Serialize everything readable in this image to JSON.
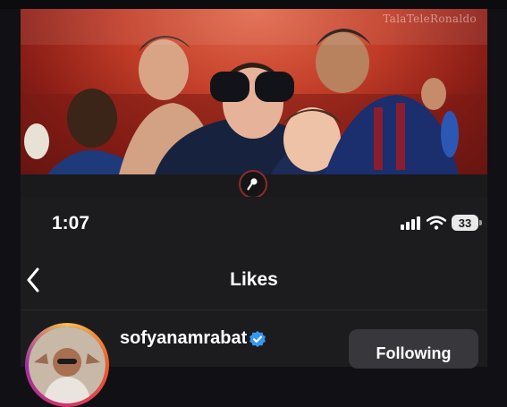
{
  "banner": {
    "watermark": "TalaTeleRonaldo"
  },
  "status_bar": {
    "time": "1:07",
    "battery_level": "33",
    "signal_icon": "signal-bars-icon",
    "wifi_icon": "wifi-icon"
  },
  "nav": {
    "back_icon": "chevron-left-icon",
    "title": "Likes"
  },
  "likes": [
    {
      "username": "sofyanamrabat",
      "verified": true,
      "action_label": "Following"
    }
  ],
  "colors": {
    "banner_red": "#c23d28",
    "verified_blue": "#3897f0",
    "button_bg": "#38373b"
  }
}
